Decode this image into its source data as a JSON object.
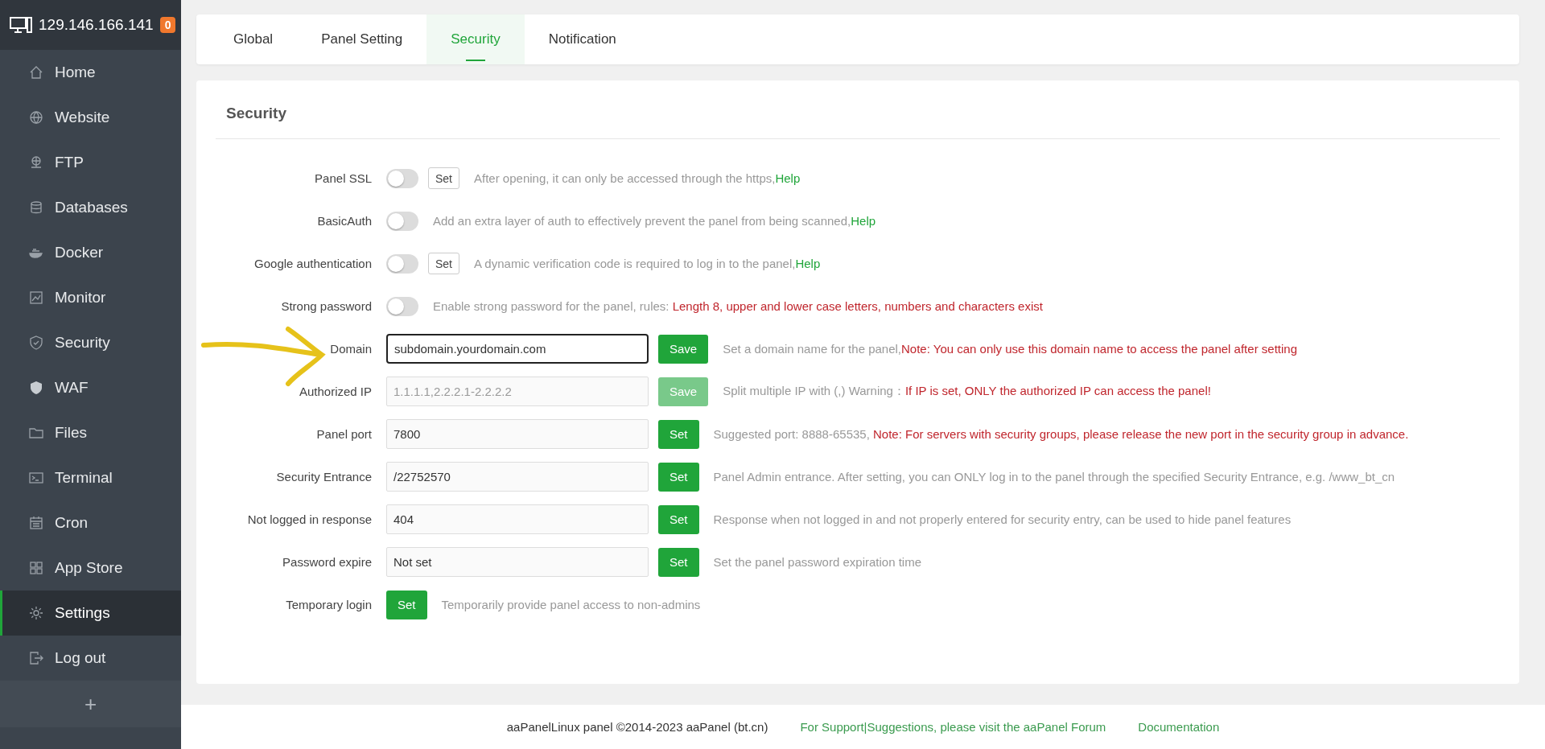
{
  "sidebar": {
    "server": "129.146.166.141",
    "badge": "0",
    "items": [
      {
        "label": "Home",
        "selected": false
      },
      {
        "label": "Website",
        "selected": false
      },
      {
        "label": "FTP",
        "selected": false
      },
      {
        "label": "Databases",
        "selected": false
      },
      {
        "label": "Docker",
        "selected": false
      },
      {
        "label": "Monitor",
        "selected": false
      },
      {
        "label": "Security",
        "selected": false
      },
      {
        "label": "WAF",
        "selected": false
      },
      {
        "label": "Files",
        "selected": false
      },
      {
        "label": "Terminal",
        "selected": false
      },
      {
        "label": "Cron",
        "selected": false
      },
      {
        "label": "App Store",
        "selected": false
      },
      {
        "label": "Settings",
        "selected": true
      },
      {
        "label": "Log out",
        "selected": false
      }
    ],
    "add": "+"
  },
  "tabs": [
    {
      "label": "Global",
      "selected": false
    },
    {
      "label": "Panel Setting",
      "selected": false
    },
    {
      "label": "Security",
      "selected": true
    },
    {
      "label": "Notification",
      "selected": false
    }
  ],
  "section_title": "Security",
  "rows": [
    {
      "label": "Panel SSL",
      "kind": "toggle",
      "on": false,
      "button": {
        "label": "Set",
        "kind": "outline",
        "disabled": false
      },
      "description": "After opening, it can only be accessed through the https,",
      "help": "Help"
    },
    {
      "label": "BasicAuth",
      "kind": "toggle",
      "on": false,
      "description": "Add an extra layer of auth to effectively prevent the panel from being scanned,",
      "help": "Help"
    },
    {
      "label": "Google authentication",
      "kind": "toggle",
      "on": false,
      "button": {
        "label": "Set",
        "kind": "outline",
        "disabled": false
      },
      "description": "A dynamic verification code is required to log in to the panel,",
      "help": "Help"
    },
    {
      "label": "Strong password",
      "kind": "toggle",
      "on": false,
      "description": "Enable strong password for the panel, rules: ",
      "note": "Length 8, upper and lower case letters, numbers and characters exist"
    },
    {
      "label": "Domain",
      "kind": "input",
      "value": "subdomain.yourdomain.com",
      "focused": true,
      "annotated": true,
      "button": {
        "label": "Save",
        "kind": "primary",
        "disabled": false
      },
      "description": "Set a domain name for the panel,",
      "note": "Note: You can only use this domain name to access the panel after setting"
    },
    {
      "label": "Authorized IP",
      "kind": "input",
      "placeholder": "1.1.1.1,2.2.2.1-2.2.2.2",
      "focused": false,
      "button": {
        "label": "Save",
        "kind": "primary",
        "disabled": true
      },
      "description": "Split multiple IP with (,) Warning：",
      "note": "If IP is set, ONLY the authorized IP can access the panel!"
    },
    {
      "label": "Panel port",
      "kind": "input",
      "value": "7800",
      "focused": false,
      "button": {
        "label": "Set",
        "kind": "primary",
        "disabled": false
      },
      "description": "Suggested port: 8888-65535, ",
      "note": "Note: For servers with security groups, please release the new port in the security group in advance."
    },
    {
      "label": "Security Entrance",
      "kind": "input",
      "value": "/22752570",
      "focused": false,
      "button": {
        "label": "Set",
        "kind": "primary",
        "disabled": false
      },
      "description": "Panel Admin entrance. After setting, you can ONLY log in to the panel through the specified Security Entrance, e.g. /www_bt_cn"
    },
    {
      "label": "Not logged in response",
      "kind": "input",
      "value": "404",
      "focused": false,
      "button": {
        "label": "Set",
        "kind": "primary",
        "disabled": false
      },
      "description": "Response when not logged in and not properly entered for security entry, can be used to hide panel features"
    },
    {
      "label": "Password expire",
      "kind": "input",
      "value": "Not set",
      "focused": false,
      "button": {
        "label": "Set",
        "kind": "primary",
        "disabled": false
      },
      "description": "Set the panel password expiration time"
    },
    {
      "label": "Temporary login",
      "kind": "button",
      "button": {
        "label": "Set",
        "kind": "primary",
        "disabled": false
      },
      "description": "Temporarily provide panel access to non-admins"
    }
  ],
  "footer": {
    "copyright": "aaPanelLinux panel ©2014-2023 aaPanel (bt.cn)",
    "links": [
      "For Support|Suggestions, please visit the aaPanel Forum",
      "Documentation"
    ]
  }
}
